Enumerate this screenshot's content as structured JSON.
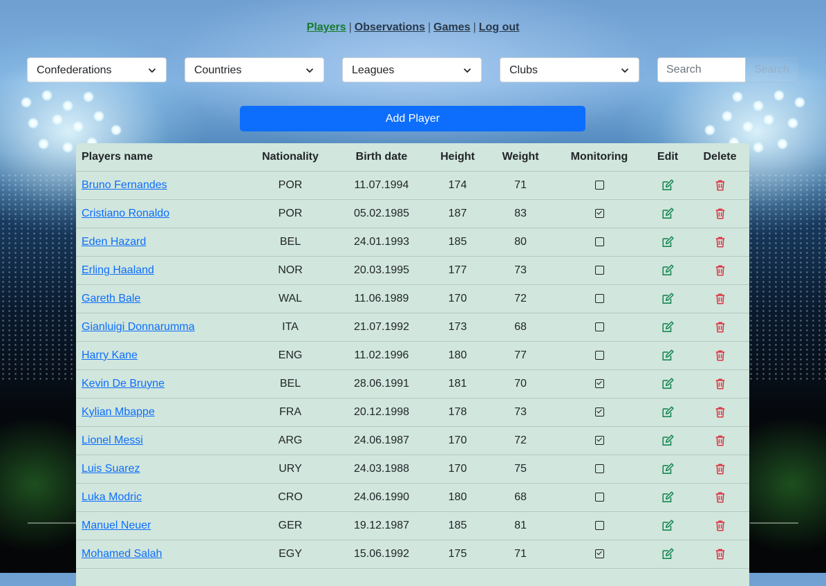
{
  "nav": {
    "items": [
      {
        "label": "Players",
        "active": true
      },
      {
        "label": "Observations",
        "active": false
      },
      {
        "label": "Games",
        "active": false
      },
      {
        "label": "Log out",
        "active": false
      }
    ],
    "separator": "|"
  },
  "filters": {
    "confederations": "Confederations",
    "countries": "Countries",
    "leagues": "Leagues",
    "clubs": "Clubs"
  },
  "search": {
    "placeholder": "Search",
    "button_label": "Search"
  },
  "add_button": "Add Player",
  "table": {
    "headers": {
      "name": "Players name",
      "nationality": "Nationality",
      "birth_date": "Birth date",
      "height": "Height",
      "weight": "Weight",
      "monitoring": "Monitoring",
      "edit": "Edit",
      "delete": "Delete"
    },
    "rows": [
      {
        "name": "Bruno Fernandes",
        "nationality": "POR",
        "birth_date": "11.07.1994",
        "height": "174",
        "weight": "71",
        "monitoring": false
      },
      {
        "name": "Cristiano Ronaldo",
        "nationality": "POR",
        "birth_date": "05.02.1985",
        "height": "187",
        "weight": "83",
        "monitoring": true
      },
      {
        "name": "Eden Hazard",
        "nationality": "BEL",
        "birth_date": "24.01.1993",
        "height": "185",
        "weight": "80",
        "monitoring": false
      },
      {
        "name": "Erling Haaland",
        "nationality": "NOR",
        "birth_date": "20.03.1995",
        "height": "177",
        "weight": "73",
        "monitoring": false
      },
      {
        "name": "Gareth Bale",
        "nationality": "WAL",
        "birth_date": "11.06.1989",
        "height": "170",
        "weight": "72",
        "monitoring": false
      },
      {
        "name": "Gianluigi Donnarumma",
        "nationality": "ITA",
        "birth_date": "21.07.1992",
        "height": "173",
        "weight": "68",
        "monitoring": false
      },
      {
        "name": "Harry Kane",
        "nationality": "ENG",
        "birth_date": "11.02.1996",
        "height": "180",
        "weight": "77",
        "monitoring": false
      },
      {
        "name": "Kevin De Bruyne",
        "nationality": "BEL",
        "birth_date": "28.06.1991",
        "height": "181",
        "weight": "70",
        "monitoring": true
      },
      {
        "name": "Kylian Mbappe",
        "nationality": "FRA",
        "birth_date": "20.12.1998",
        "height": "178",
        "weight": "73",
        "monitoring": true
      },
      {
        "name": "Lionel Messi",
        "nationality": "ARG",
        "birth_date": "24.06.1987",
        "height": "170",
        "weight": "72",
        "monitoring": true
      },
      {
        "name": "Luis Suarez",
        "nationality": "URY",
        "birth_date": "24.03.1988",
        "height": "170",
        "weight": "75",
        "monitoring": false
      },
      {
        "name": "Luka Modric",
        "nationality": "CRO",
        "birth_date": "24.06.1990",
        "height": "180",
        "weight": "68",
        "monitoring": false
      },
      {
        "name": "Manuel Neuer",
        "nationality": "GER",
        "birth_date": "19.12.1987",
        "height": "185",
        "weight": "81",
        "monitoring": false
      },
      {
        "name": "Mohamed Salah",
        "nationality": "EGY",
        "birth_date": "15.06.1992",
        "height": "175",
        "weight": "71",
        "monitoring": true
      }
    ]
  },
  "colors": {
    "accent": "#0d6efd",
    "active_nav": "#167a2c",
    "edit_icon": "#198754",
    "delete_icon": "#dc3545",
    "table_bg": "#d1e6dc"
  },
  "icons": {
    "chevron": "chevron-down-icon",
    "edit": "edit-icon",
    "delete": "trash-icon",
    "checkbox": "checkbox-icon"
  }
}
